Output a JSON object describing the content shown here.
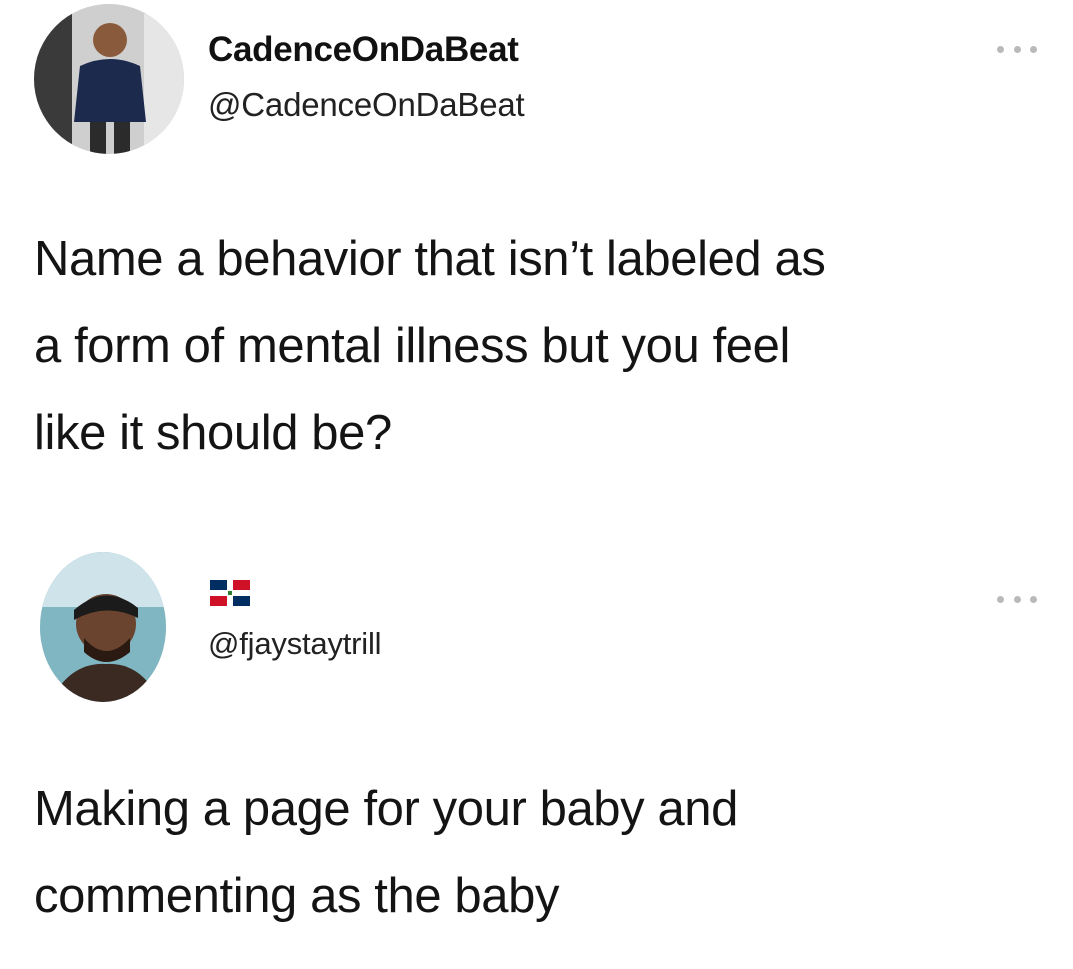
{
  "tweets": [
    {
      "display_name": "CadenceOnDaBeat",
      "handle": "@CadenceOnDaBeat",
      "avatar_icon": "profile-photo-man-in-navy-sweater",
      "more_icon": "more-horizontal-icon",
      "text_lines": [
        "Name a behavior that isn’t labeled as",
        "a form of mental illness but you feel",
        "like it should be?"
      ]
    },
    {
      "display_name": "",
      "name_icon": "dominican-republic-flag-icon",
      "handle": "@fjaystaytrill",
      "avatar_icon": "profile-photo-man-with-bandana",
      "more_icon": "more-horizontal-icon",
      "text_lines": [
        "Making a page for your baby and",
        "commenting as the baby"
      ]
    }
  ],
  "colors": {
    "background": "#ffffff",
    "text": "#141414",
    "more_dots": "#b9b9b9",
    "flag_blue": "#002d62",
    "flag_red": "#ce1126"
  }
}
